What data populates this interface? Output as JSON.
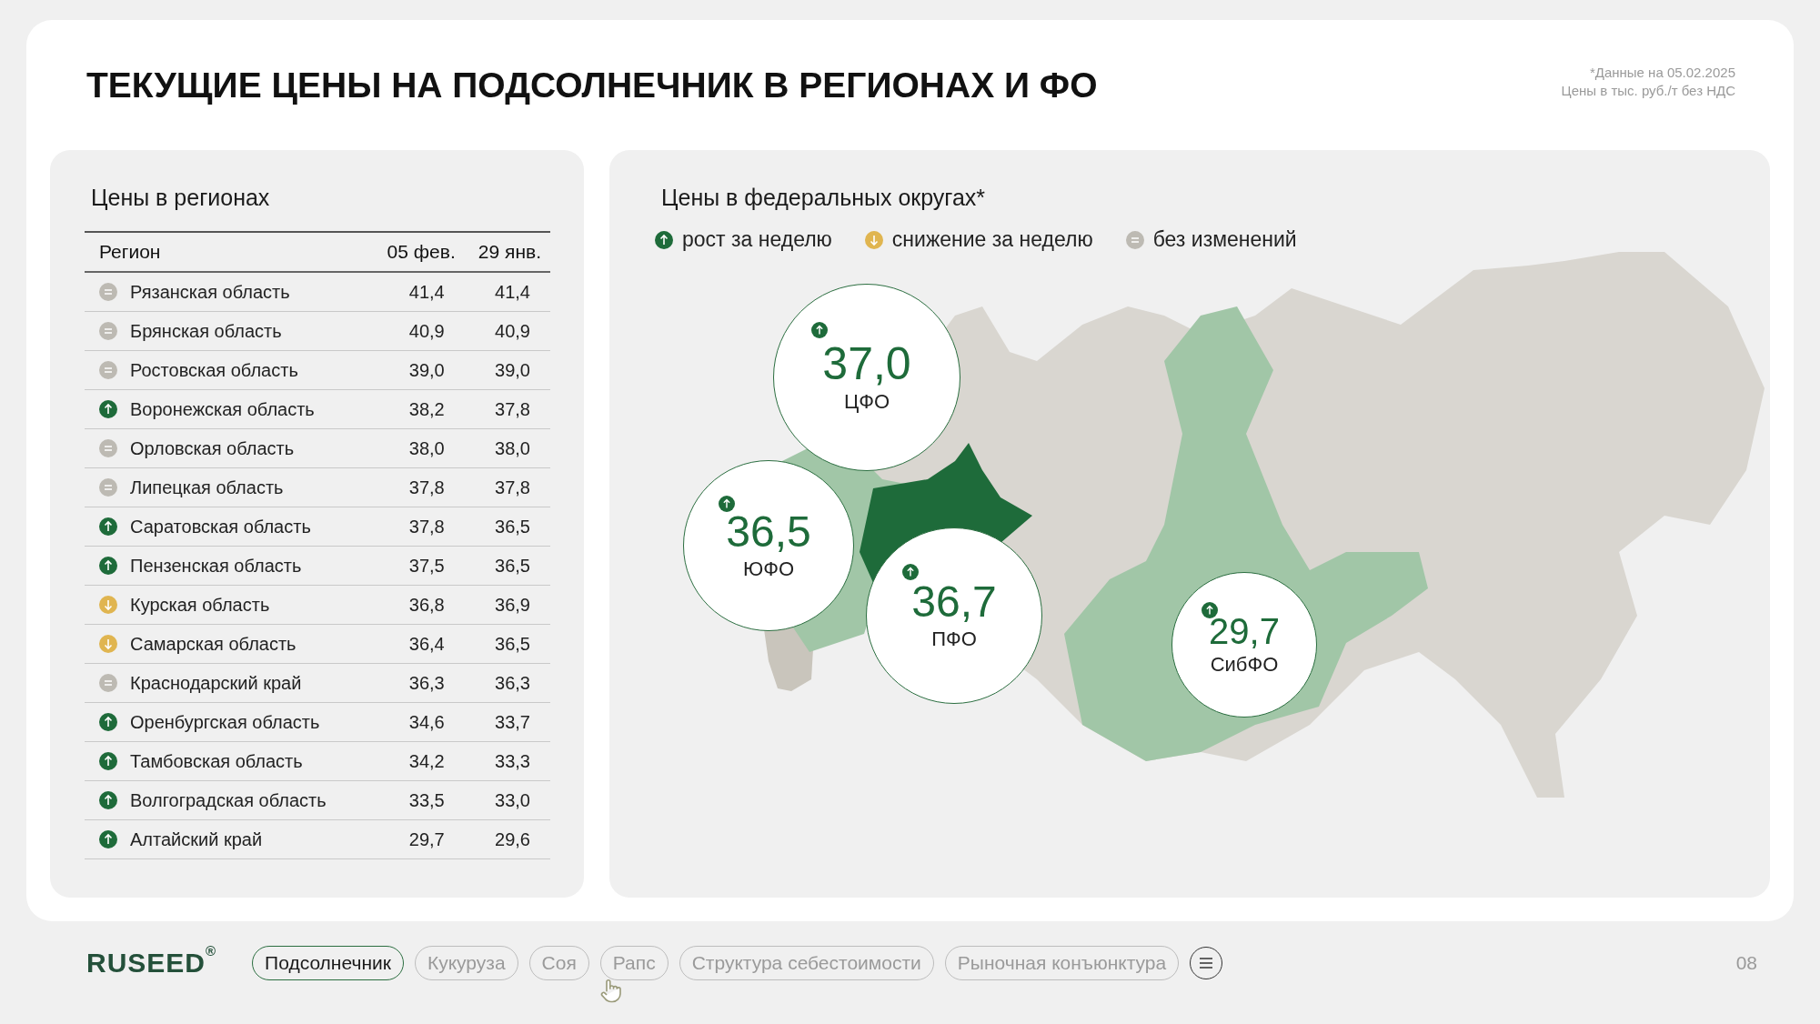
{
  "header": {
    "title": "ТЕКУЩИЕ ЦЕНЫ НА ПОДСОЛНЕЧНИК В РЕГИОНАХ И ФО",
    "notes": [
      "*Данные на 05.02.2025",
      "Цены в тыс. руб./т без НДС"
    ]
  },
  "regions_panel": {
    "title": "Цены в регионах",
    "columns": [
      "Регион",
      "05 фев.",
      "29 янв."
    ],
    "rows": [
      {
        "kind": "same",
        "region": "Рязанская область",
        "current": "41,4",
        "previous": "41,4"
      },
      {
        "kind": "same",
        "region": "Брянская область",
        "current": "40,9",
        "previous": "40,9"
      },
      {
        "kind": "same",
        "region": "Ростовская область",
        "current": "39,0",
        "previous": "39,0"
      },
      {
        "kind": "up",
        "region": "Воронежская область",
        "current": "38,2",
        "previous": "37,8"
      },
      {
        "kind": "same",
        "region": "Орловская область",
        "current": "38,0",
        "previous": "38,0"
      },
      {
        "kind": "same",
        "region": "Липецкая область",
        "current": "37,8",
        "previous": "37,8"
      },
      {
        "kind": "up",
        "region": "Саратовская область",
        "current": "37,8",
        "previous": "36,5"
      },
      {
        "kind": "up",
        "region": "Пензенская область",
        "current": "37,5",
        "previous": "36,5"
      },
      {
        "kind": "down",
        "region": "Курская область",
        "current": "36,8",
        "previous": "36,9"
      },
      {
        "kind": "down",
        "region": "Самарская область",
        "current": "36,4",
        "previous": "36,5"
      },
      {
        "kind": "same",
        "region": "Краснодарский край",
        "current": "36,3",
        "previous": "36,3"
      },
      {
        "kind": "up",
        "region": "Оренбургская область",
        "current": "34,6",
        "previous": "33,7"
      },
      {
        "kind": "up",
        "region": "Тамбовская область",
        "current": "34,2",
        "previous": "33,3"
      },
      {
        "kind": "up",
        "region": "Волгоградская область",
        "current": "33,5",
        "previous": "33,0"
      },
      {
        "kind": "up",
        "region": "Алтайский край",
        "current": "29,7",
        "previous": "29,6"
      }
    ]
  },
  "districts_panel": {
    "title": "Цены в федеральных округах*",
    "legend": [
      {
        "kind": "up",
        "label": "рост за неделю"
      },
      {
        "kind": "down",
        "label": "снижение за неделю"
      },
      {
        "kind": "same",
        "label": "без изменений"
      }
    ],
    "districts": [
      {
        "kind": "up",
        "value": "37,0",
        "name": "ЦФО"
      },
      {
        "kind": "up",
        "value": "36,5",
        "name": "ЮФО"
      },
      {
        "kind": "up",
        "value": "36,7",
        "name": "ПФО"
      },
      {
        "kind": "up",
        "value": "29,7",
        "name": "СибФО"
      }
    ]
  },
  "footer": {
    "logo": "RUSEED",
    "logo_mark": "®",
    "tabs": [
      {
        "label": "Подсолнечник",
        "selected": true
      },
      {
        "label": "Кукуруза",
        "selected": false
      },
      {
        "label": "Соя",
        "selected": false
      },
      {
        "label": "Рапс",
        "selected": false
      },
      {
        "label": "Структура себестоимости",
        "selected": false
      },
      {
        "label": "Рыночная конъюнктура",
        "selected": false
      }
    ],
    "page_number": "08"
  }
}
